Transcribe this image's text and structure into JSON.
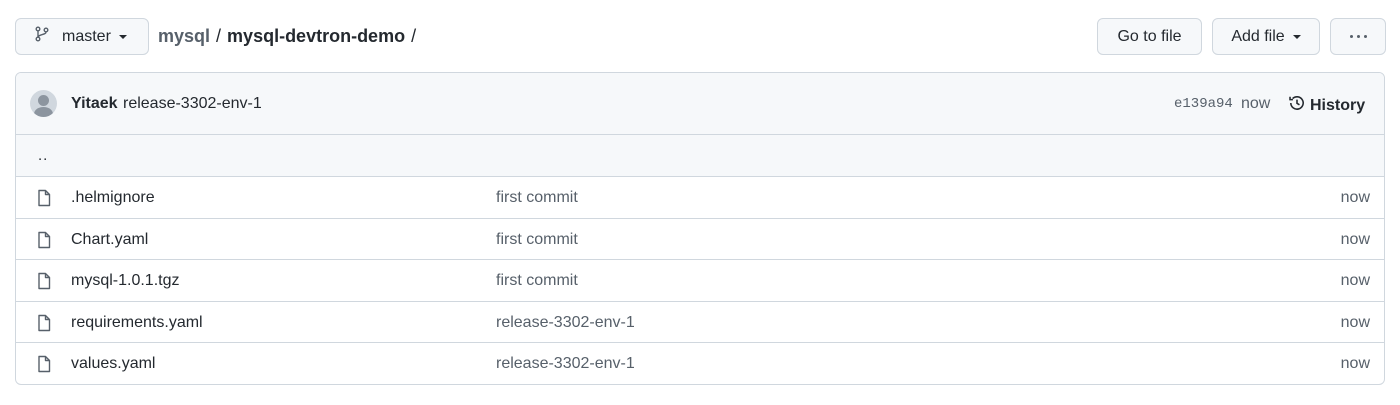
{
  "toolbar": {
    "branch": "master",
    "breadcrumb": {
      "root": "mysql",
      "separator": "/",
      "current": "mysql-devtron-demo",
      "trailing": "/"
    },
    "goto_file": "Go to file",
    "add_file": "Add file"
  },
  "commit": {
    "author": "Yitaek",
    "message": "release-3302-env-1",
    "sha": "e139a94",
    "time": "now",
    "history_label": "History"
  },
  "parent_dir": "..",
  "files": [
    {
      "name": ".helmignore",
      "commit": "first commit",
      "time": "now"
    },
    {
      "name": "Chart.yaml",
      "commit": "first commit",
      "time": "now"
    },
    {
      "name": "mysql-1.0.1.tgz",
      "commit": "first commit",
      "time": "now"
    },
    {
      "name": "requirements.yaml",
      "commit": "release-3302-env-1",
      "time": "now"
    },
    {
      "name": "values.yaml",
      "commit": "release-3302-env-1",
      "time": "now"
    }
  ],
  "icons": {
    "branch": "git-branch-icon",
    "more": "kebab-horizontal-icon",
    "history": "history-icon",
    "file": "file-icon"
  },
  "colors": {
    "border": "#d0d7de",
    "header_bg": "#f6f8fa",
    "text": "#24292f",
    "muted": "#57606a"
  }
}
